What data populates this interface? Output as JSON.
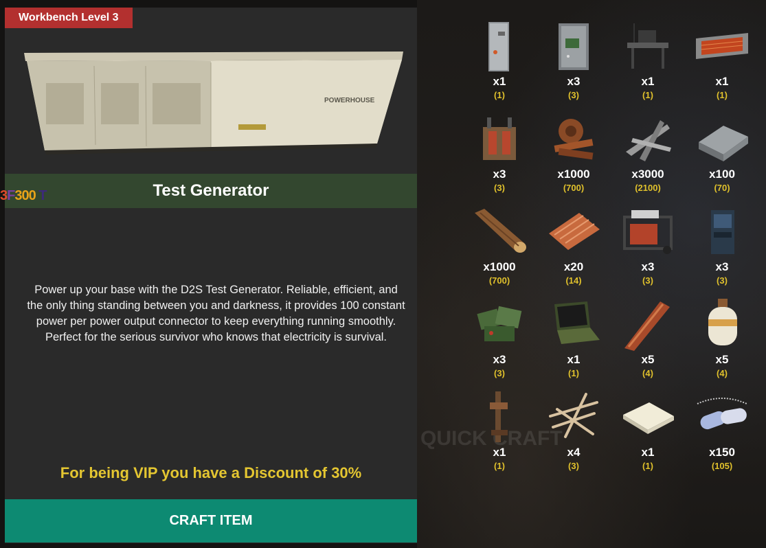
{
  "workbench_label": "Workbench Level 3",
  "item": {
    "title": "Test Generator",
    "description": "Power up your base with the D2S Test Generator. Reliable, efficient, and the only thing standing between you and darkness, it provides 100 constant power per power output connector to keep everything running smoothly. Perfect for the serious survivor who knows that electricity is survival."
  },
  "overlay_glitch": {
    "prefix": "3",
    "mid": "F",
    "value": "300",
    "suffix": "T"
  },
  "discount_text": "For being VIP you have a Discount of 30%",
  "craft_button": "CRAFT ITEM",
  "background_ghost": {
    "heading": "QUICK CRAFT"
  },
  "colors": {
    "badge": "#b3302f",
    "title_bar": "#33472f",
    "craft_button": "#0d8a72",
    "vip_text": "#e4c631",
    "have_text": "#e0c12c"
  },
  "ingredients": [
    {
      "icon": "electrical-box-icon",
      "qty": "x1",
      "have": "(1)"
    },
    {
      "icon": "circuit-box-icon",
      "qty": "x3",
      "have": "(3)"
    },
    {
      "icon": "computer-station-icon",
      "qty": "x1",
      "have": "(1)"
    },
    {
      "icon": "electric-heater-icon",
      "qty": "x1",
      "have": "(1)"
    },
    {
      "icon": "transformer-icon",
      "qty": "x3",
      "have": "(3)"
    },
    {
      "icon": "metal-fragments-icon",
      "qty": "x1000",
      "have": "(700)"
    },
    {
      "icon": "scrap-icon",
      "qty": "x3000",
      "have": "(2100)"
    },
    {
      "icon": "metal-ingot-icon",
      "qty": "x100",
      "have": "(70)"
    },
    {
      "icon": "wood-log-icon",
      "qty": "x1000",
      "have": "(700)"
    },
    {
      "icon": "sheet-metal-icon",
      "qty": "x20",
      "have": "(14)"
    },
    {
      "icon": "small-generator-icon",
      "qty": "x3",
      "have": "(3)"
    },
    {
      "icon": "battery-icon",
      "qty": "x3",
      "have": "(3)"
    },
    {
      "icon": "tech-trash-icon",
      "qty": "x3",
      "have": "(3)"
    },
    {
      "icon": "laptop-icon",
      "qty": "x1",
      "have": "(1)"
    },
    {
      "icon": "metal-pipe-icon",
      "qty": "x5",
      "have": "(4)"
    },
    {
      "icon": "propane-tank-icon",
      "qty": "x5",
      "have": "(4)"
    },
    {
      "icon": "tripod-icon",
      "qty": "x1",
      "have": "(1)"
    },
    {
      "icon": "sticks-icon",
      "qty": "x4",
      "have": "(3)"
    },
    {
      "icon": "paper-icon",
      "qty": "x1",
      "have": "(1)"
    },
    {
      "icon": "dog-tags-icon",
      "qty": "x150",
      "have": "(105)"
    }
  ]
}
